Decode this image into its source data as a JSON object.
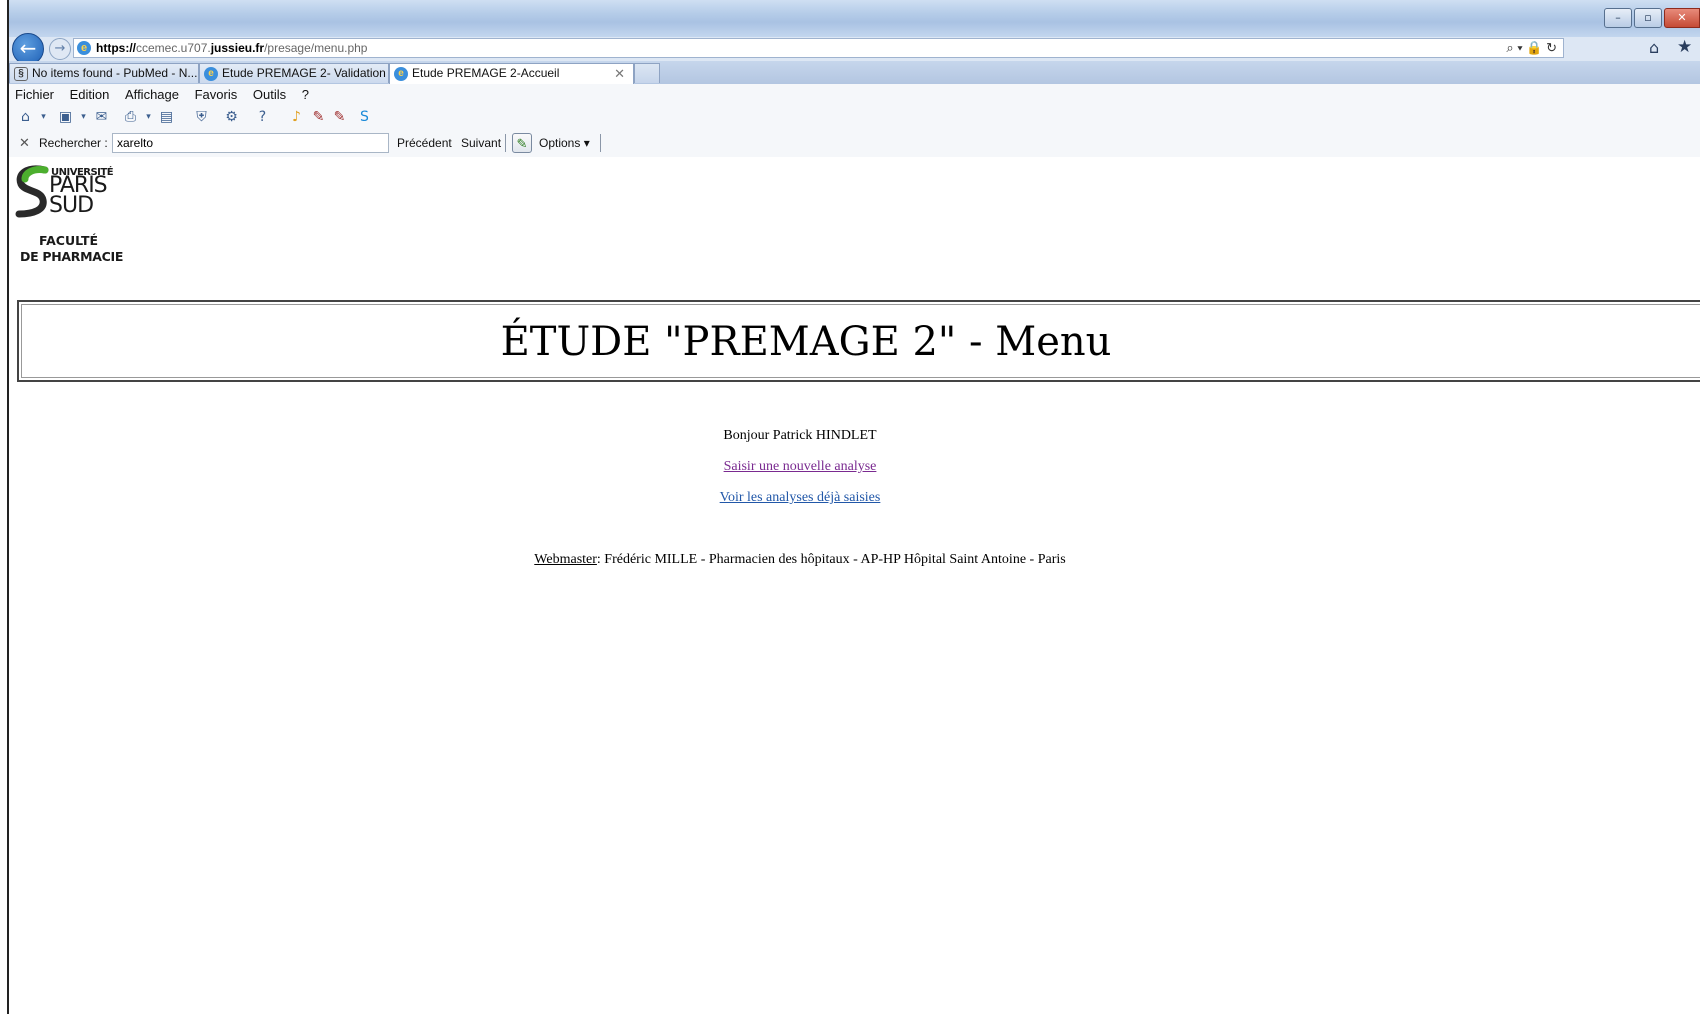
{
  "browser": {
    "address": {
      "scheme": "https://",
      "host_pre": "ccemec.u707.",
      "host_main": "jussieu.fr",
      "path": "/presage/menu.php"
    },
    "address_actions": "⌕ ▾ 🔒 ↻",
    "tabs": [
      {
        "label": "No items found - PubMed - N...",
        "icon": "pubmed-icon"
      },
      {
        "label": "Etude PREMAGE 2- Validation ...",
        "icon": "ie-icon"
      },
      {
        "label": "Etude PREMAGE 2-Accueil",
        "icon": "ie-icon",
        "active": true
      }
    ],
    "menu": [
      "Fichier",
      "Edition",
      "Affichage",
      "Favoris",
      "Outils",
      "?"
    ],
    "find": {
      "label": "Rechercher :",
      "value": "xarelto",
      "prev": "Précédent",
      "next": "Suivant",
      "options": "Options ▾"
    }
  },
  "logo": {
    "line1": "UNIVERSITÉ",
    "line2": "PARIS",
    "line3": "SUD",
    "line4": "FACULTÉ",
    "line5": "DE PHARMACIE"
  },
  "page": {
    "title": "ÉTUDE \"PREMAGE 2\" - Menu",
    "greeting": "Bonjour Patrick HINDLET",
    "link_new": "Saisir une nouvelle analyse",
    "link_view": "Voir les analyses déjà saisies",
    "webmaster_label": "Webmaster",
    "webmaster_text": ": Frédéric MILLE - Pharmacien des hôpitaux - AP-HP Hôpital Saint Antoine - Paris"
  },
  "colors": {
    "link": "#2157a8",
    "visited_link": "#7a2a90",
    "chrome": "#b6cde9"
  }
}
